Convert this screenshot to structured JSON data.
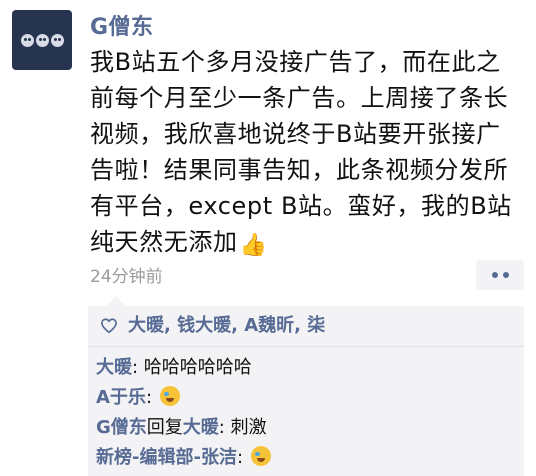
{
  "post": {
    "author": "G僧东",
    "text": "我B站五个多月没接广告了，而在此之\n前每个月至少一条广告。上周接了条长\n视频，我欣喜地说终于B站要开张接广\n告啦！结果同事告知，此条视频分发所\n有平台，except B站。蛮好，我的B站\n纯天然无添加",
    "trailing_emoji": "👍",
    "timestamp": "24分钟前"
  },
  "likes": {
    "names": "大暖, 钱大暖, A魏昕, 柒"
  },
  "comments": [
    {
      "name": "大暖",
      "separator": ": ",
      "text": "哈哈哈哈哈哈"
    },
    {
      "name": "A于乐",
      "separator": ": ",
      "emoji": "laughing-crying-emoji"
    },
    {
      "name": "G僧东",
      "reply_word": "回复",
      "reply_to": "大暖",
      "separator": ": ",
      "text": "刺激"
    },
    {
      "name": "新榜-编辑部-张洁",
      "separator": ": ",
      "emoji": "laughing-crying-emoji"
    }
  ],
  "colors": {
    "link": "#576b95",
    "panel": "#f3f3f5",
    "text": "#111111",
    "muted": "#9b9b9b"
  }
}
